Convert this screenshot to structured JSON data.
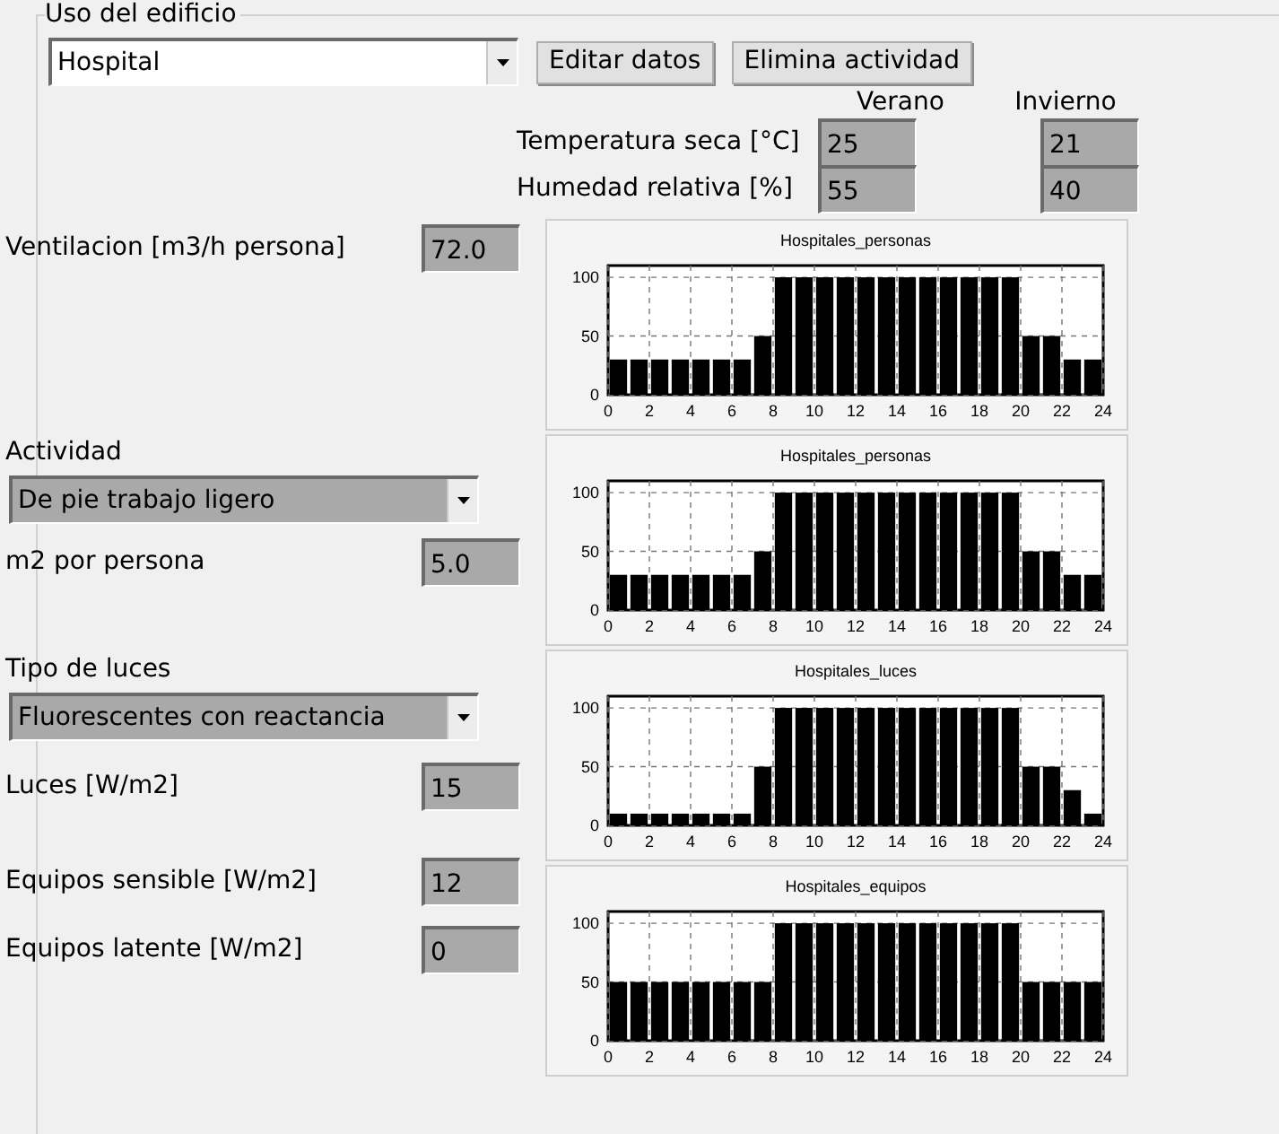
{
  "group": {
    "title": "Uso del edificio"
  },
  "building_use": {
    "value": "Hospital"
  },
  "buttons": [
    "Editar datos",
    "Elimina actividad"
  ],
  "season_headers": [
    "Verano",
    "Invierno"
  ],
  "conditions": [
    {
      "label": "Temperatura seca [°C]",
      "summer": "25",
      "winter": "21"
    },
    {
      "label": "Humedad relativa [%]",
      "summer": "55",
      "winter": "40"
    }
  ],
  "ventilation": {
    "label": "Ventilacion [m3/h persona]",
    "value": "72.0"
  },
  "activity": {
    "label": "Actividad",
    "value": "De pie trabajo ligero"
  },
  "area_per_person": {
    "label": "m2 por persona",
    "value": "5.0"
  },
  "light_type": {
    "label": "Tipo de luces",
    "value": "Fluorescentes con reactancia"
  },
  "lights": {
    "label": "Luces [W/m2]",
    "value": "15"
  },
  "equipment_sensible": {
    "label": "Equipos sensible [W/m2]",
    "value": "12"
  },
  "equipment_latent": {
    "label": "Equipos latente [W/m2]",
    "value": "0"
  },
  "charts": [
    {
      "chart_data": {
        "type": "bar",
        "title": "Hospitales_personas",
        "grid": true,
        "x": [
          0.5,
          1.5,
          2.5,
          3.5,
          4.5,
          5.5,
          6.5,
          7.5,
          8.5,
          9.5,
          10.5,
          11.5,
          12.5,
          13.5,
          14.5,
          15.5,
          16.5,
          17.5,
          18.5,
          19.5,
          20.5,
          21.5,
          22.5,
          23.5
        ],
        "values": [
          30,
          30,
          30,
          30,
          30,
          30,
          30,
          50,
          100,
          100,
          100,
          100,
          100,
          100,
          100,
          100,
          100,
          100,
          100,
          100,
          50,
          50,
          30,
          30
        ],
        "xlim": [
          0,
          24
        ],
        "ylim": [
          0,
          110
        ],
        "xticks": [
          0,
          2,
          4,
          6,
          8,
          10,
          12,
          14,
          16,
          18,
          20,
          22,
          24
        ],
        "yticks": [
          0,
          50,
          100
        ]
      }
    },
    {
      "chart_data": {
        "type": "bar",
        "title": "Hospitales_personas",
        "grid": true,
        "x": [
          0.5,
          1.5,
          2.5,
          3.5,
          4.5,
          5.5,
          6.5,
          7.5,
          8.5,
          9.5,
          10.5,
          11.5,
          12.5,
          13.5,
          14.5,
          15.5,
          16.5,
          17.5,
          18.5,
          19.5,
          20.5,
          21.5,
          22.5,
          23.5
        ],
        "values": [
          30,
          30,
          30,
          30,
          30,
          30,
          30,
          50,
          100,
          100,
          100,
          100,
          100,
          100,
          100,
          100,
          100,
          100,
          100,
          100,
          50,
          50,
          30,
          30
        ],
        "xlim": [
          0,
          24
        ],
        "ylim": [
          0,
          110
        ],
        "xticks": [
          0,
          2,
          4,
          6,
          8,
          10,
          12,
          14,
          16,
          18,
          20,
          22,
          24
        ],
        "yticks": [
          0,
          50,
          100
        ]
      }
    },
    {
      "chart_data": {
        "type": "bar",
        "title": "Hospitales_luces",
        "grid": true,
        "x": [
          0.5,
          1.5,
          2.5,
          3.5,
          4.5,
          5.5,
          6.5,
          7.5,
          8.5,
          9.5,
          10.5,
          11.5,
          12.5,
          13.5,
          14.5,
          15.5,
          16.5,
          17.5,
          18.5,
          19.5,
          20.5,
          21.5,
          22.5,
          23.5
        ],
        "values": [
          10,
          10,
          10,
          10,
          10,
          10,
          10,
          50,
          100,
          100,
          100,
          100,
          100,
          100,
          100,
          100,
          100,
          100,
          100,
          100,
          50,
          50,
          30,
          10
        ],
        "xlim": [
          0,
          24
        ],
        "ylim": [
          0,
          110
        ],
        "xticks": [
          0,
          2,
          4,
          6,
          8,
          10,
          12,
          14,
          16,
          18,
          20,
          22,
          24
        ],
        "yticks": [
          0,
          50,
          100
        ]
      }
    },
    {
      "chart_data": {
        "type": "bar",
        "title": "Hospitales_equipos",
        "grid": true,
        "x": [
          0.5,
          1.5,
          2.5,
          3.5,
          4.5,
          5.5,
          6.5,
          7.5,
          8.5,
          9.5,
          10.5,
          11.5,
          12.5,
          13.5,
          14.5,
          15.5,
          16.5,
          17.5,
          18.5,
          19.5,
          20.5,
          21.5,
          22.5,
          23.5
        ],
        "values": [
          50,
          50,
          50,
          50,
          50,
          50,
          50,
          50,
          100,
          100,
          100,
          100,
          100,
          100,
          100,
          100,
          100,
          100,
          100,
          100,
          50,
          50,
          50,
          50
        ],
        "xlim": [
          0,
          24
        ],
        "ylim": [
          0,
          110
        ],
        "xticks": [
          0,
          2,
          4,
          6,
          8,
          10,
          12,
          14,
          16,
          18,
          20,
          22,
          24
        ],
        "yticks": [
          0,
          50,
          100
        ]
      }
    }
  ]
}
